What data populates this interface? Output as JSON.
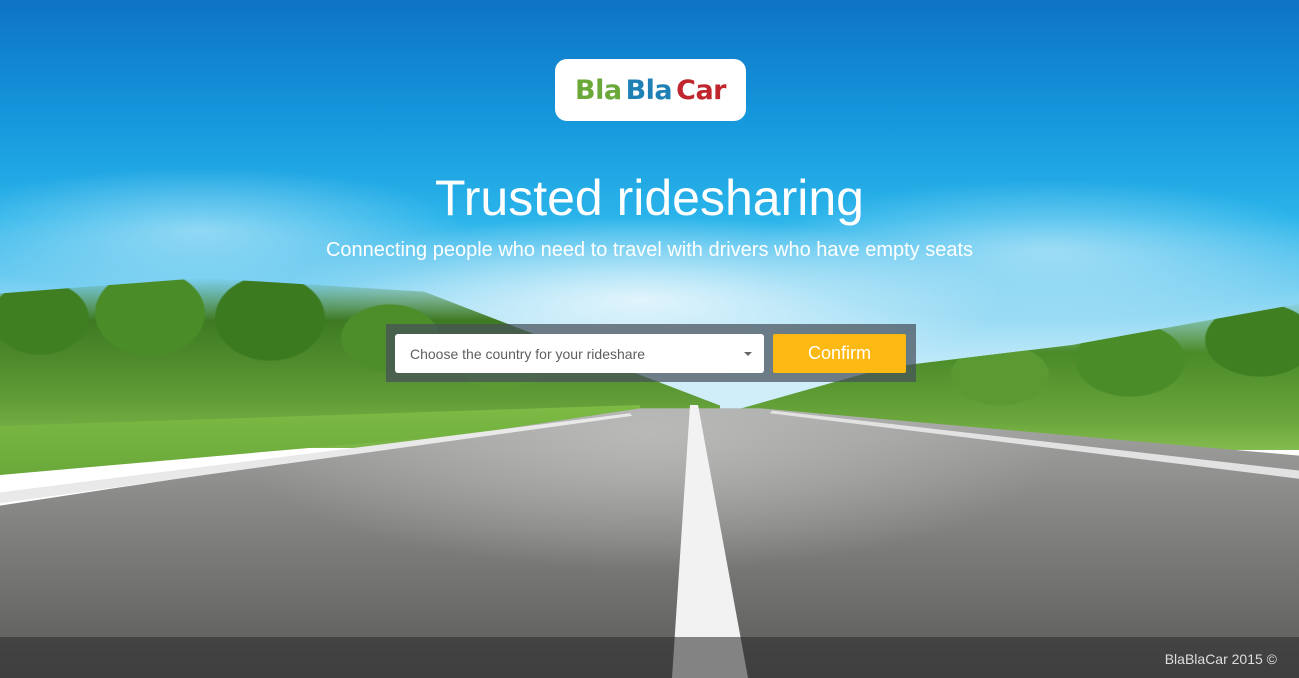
{
  "brand": {
    "logo_word1": "Bla",
    "logo_word2": "Bla",
    "logo_word3": "Car",
    "colors": {
      "green": "#6aa83a",
      "blue": "#1f80b5",
      "red": "#c0262d"
    }
  },
  "hero": {
    "title": "Trusted ridesharing",
    "subtitle": "Connecting people who need to travel with drivers who have empty seats"
  },
  "form": {
    "country_placeholder": "Choose the country for your rideshare",
    "confirm_label": "Confirm",
    "accent": "#fdb913"
  },
  "footer": {
    "copyright": "BlaBlaCar 2015 ©"
  }
}
